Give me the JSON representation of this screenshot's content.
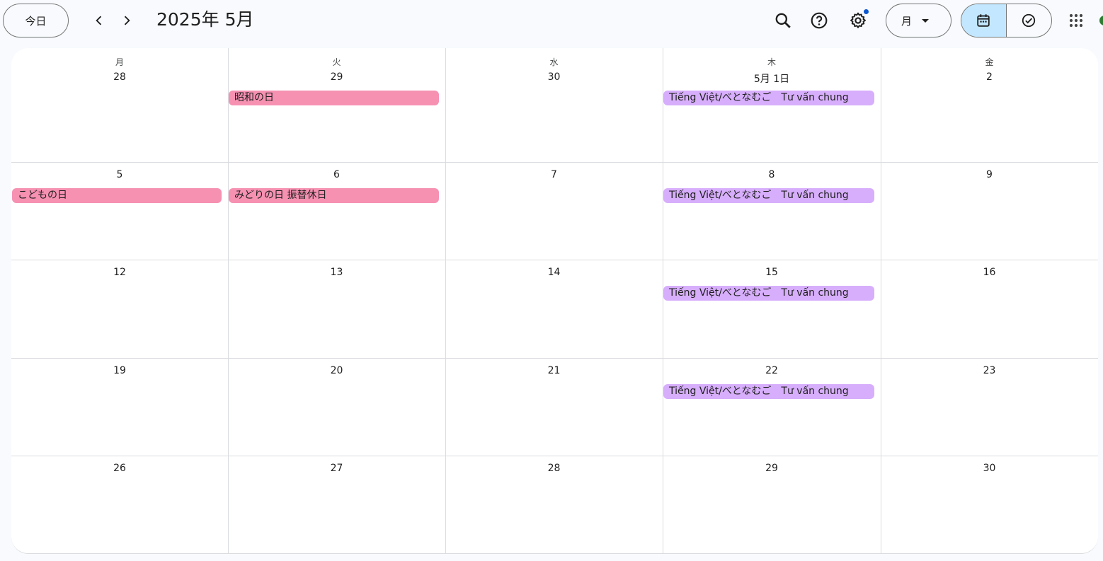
{
  "header": {
    "today_label": "今日",
    "title": "2025年 5月",
    "view_select_label": "月"
  },
  "icons": {
    "prev": "chevron-left-icon",
    "next": "chevron-right-icon",
    "search": "search-icon",
    "help": "help-icon",
    "settings": "gear-icon",
    "calendar_view": "calendar-icon",
    "tasks_view": "task-check-icon",
    "apps": "apps-grid-icon"
  },
  "colors": {
    "holiday": "#f691b2",
    "lesson": "#d7aefb",
    "active_segment": "#c2e7ff",
    "notification_dot": "#0b57d0"
  },
  "weekdays": [
    "月",
    "火",
    "水",
    "木",
    "金"
  ],
  "weeks": [
    {
      "days": [
        "28",
        "29",
        "30",
        "5月 1日",
        "2"
      ],
      "events": [
        {
          "type": "holiday",
          "col": 1,
          "title": "昭和の日"
        },
        {
          "type": "lesson",
          "col": 3,
          "title": "Tiếng Việt/べとなむご",
          "subtitle": "Tư vấn chung"
        }
      ]
    },
    {
      "days": [
        "5",
        "6",
        "7",
        "8",
        "9"
      ],
      "events": [
        {
          "type": "holiday",
          "col": 0,
          "title": "こどもの日"
        },
        {
          "type": "holiday",
          "col": 1,
          "title": "みどりの日 振替休日"
        },
        {
          "type": "lesson",
          "col": 3,
          "title": "Tiếng Việt/べとなむご",
          "subtitle": "Tư vấn chung"
        }
      ]
    },
    {
      "days": [
        "12",
        "13",
        "14",
        "15",
        "16"
      ],
      "events": [
        {
          "type": "lesson",
          "col": 3,
          "title": "Tiếng Việt/べとなむご",
          "subtitle": "Tư vấn chung"
        }
      ]
    },
    {
      "days": [
        "19",
        "20",
        "21",
        "22",
        "23"
      ],
      "events": [
        {
          "type": "lesson",
          "col": 3,
          "title": "Tiếng Việt/べとなむご",
          "subtitle": "Tư vấn chung"
        }
      ]
    },
    {
      "days": [
        "26",
        "27",
        "28",
        "29",
        "30"
      ],
      "events": []
    }
  ]
}
